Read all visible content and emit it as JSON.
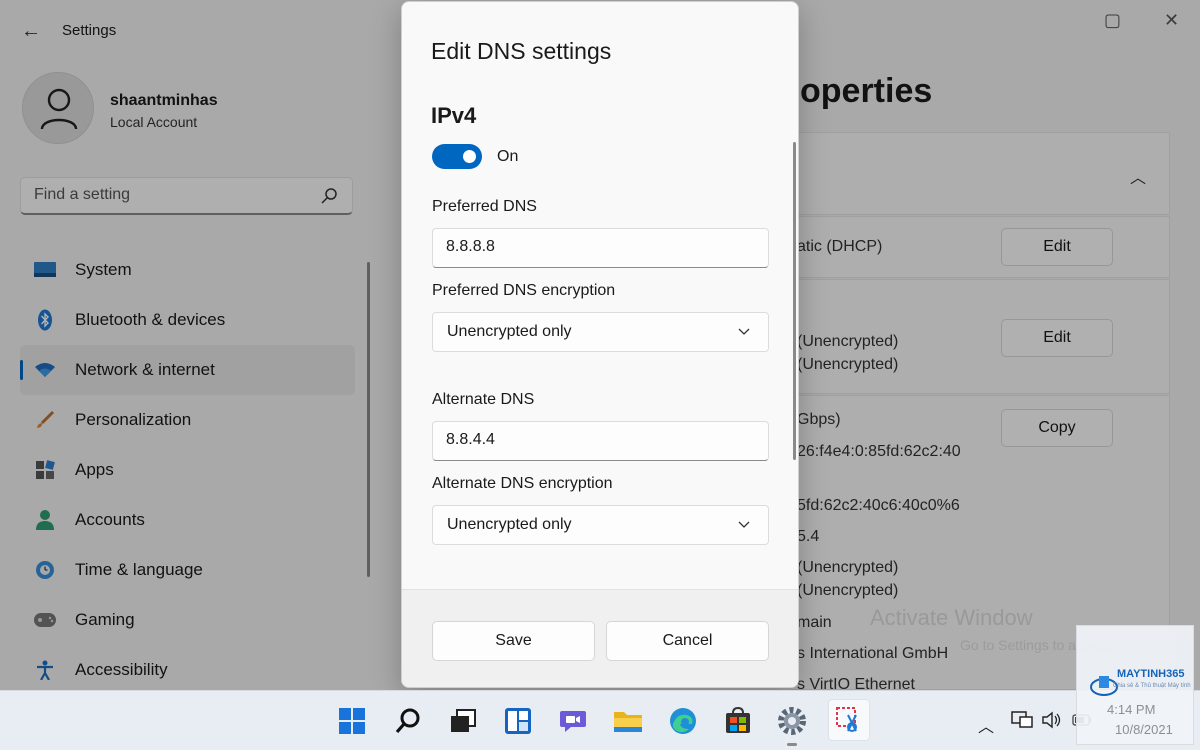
{
  "app": {
    "title": "Settings",
    "back_label": "←"
  },
  "profile": {
    "name": "shaantminhas",
    "account_type": "Local Account"
  },
  "search": {
    "placeholder": "Find a setting"
  },
  "sidebar": {
    "items": [
      {
        "label": "System",
        "icon": "system-icon"
      },
      {
        "label": "Bluetooth & devices",
        "icon": "bluetooth-icon"
      },
      {
        "label": "Network & internet",
        "icon": "wifi-icon",
        "active": true
      },
      {
        "label": "Personalization",
        "icon": "brush-icon"
      },
      {
        "label": "Apps",
        "icon": "apps-icon"
      },
      {
        "label": "Accounts",
        "icon": "person-icon"
      },
      {
        "label": "Time & language",
        "icon": "clock-globe-icon"
      },
      {
        "label": "Gaming",
        "icon": "gamepad-icon"
      },
      {
        "label": "Accessibility",
        "icon": "accessibility-icon"
      }
    ]
  },
  "background": {
    "title_fragment": "operties",
    "dhcp_text": "atic (DHCP)",
    "enc_1": "(Unencrypted)",
    "enc_2": "(Unencrypted)",
    "speed": "Gbps)",
    "ipv6": "26:f4e4:0:85fd:62c2:40",
    "ipv6_link": "5fd:62c2:40c6:40c0%6",
    "dns_frag": "5.4",
    "enc_3": "(Unencrypted)",
    "enc_4": "(Unencrypted)",
    "domain": "main",
    "manufacturer": "s International GmbH",
    "adapter": "s VirtIO Ethernet",
    "edit_1": "Edit",
    "edit_2": "Edit",
    "copy": "Copy",
    "watermark_title": "Activate Window",
    "watermark_sub": "Go to Settings to activate"
  },
  "dialog": {
    "title": "Edit DNS settings",
    "section": "IPv4",
    "toggle_state": "On",
    "preferred_label": "Preferred DNS",
    "preferred_value": "8.8.8.8",
    "preferred_enc_label": "Preferred DNS encryption",
    "preferred_enc_value": "Unencrypted only",
    "alternate_label": "Alternate DNS",
    "alternate_value": "8.8.4.4",
    "alternate_enc_label": "Alternate DNS encryption",
    "alternate_enc_value": "Unencrypted only",
    "save": "Save",
    "cancel": "Cancel"
  },
  "taskbar": {
    "time": "4:14 PM",
    "date": "10/8/2021",
    "brand": "MAYTINH365",
    "brand_sub": "Chia sẻ & Thủ thuật Máy tính"
  },
  "colors": {
    "accent": "#0067c0"
  }
}
